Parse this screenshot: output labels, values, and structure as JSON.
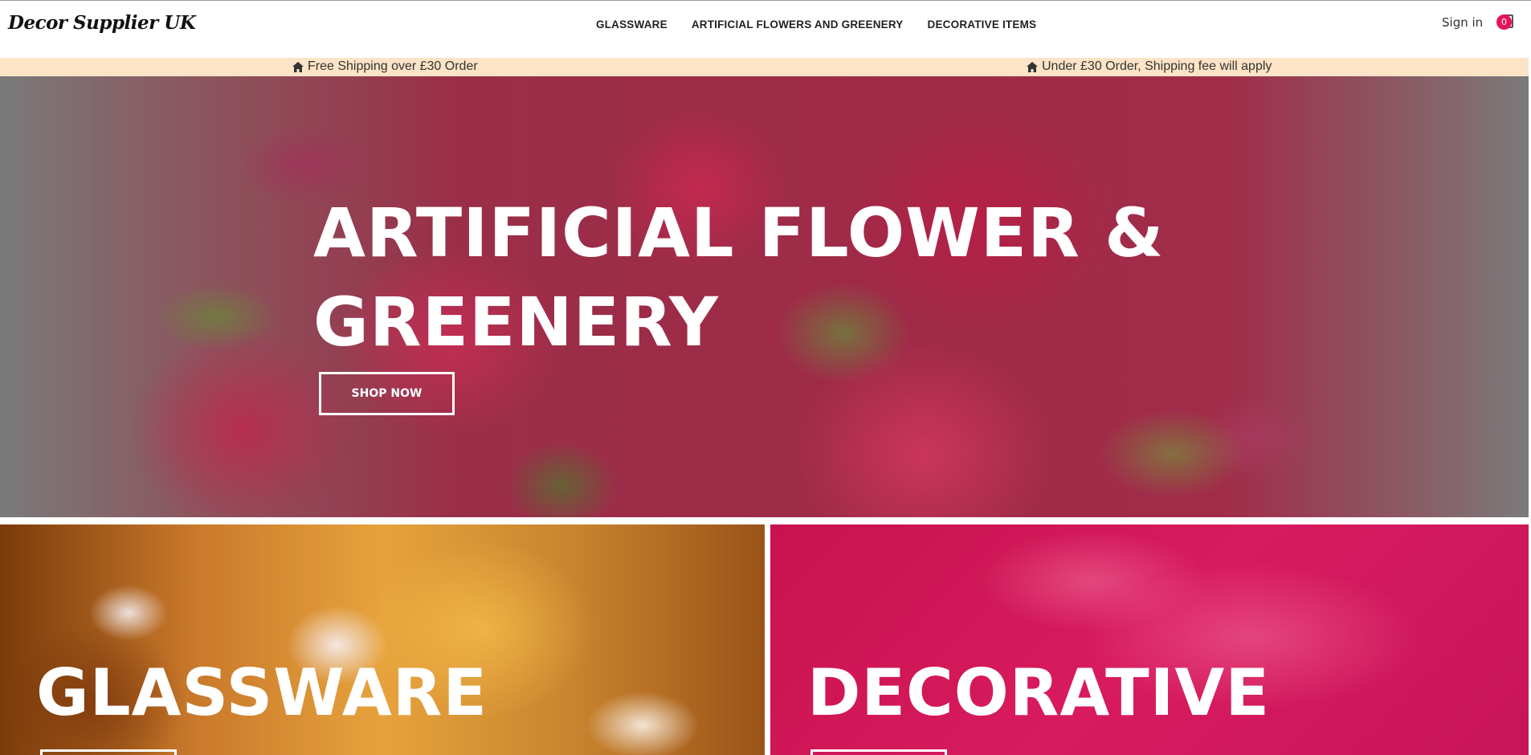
{
  "header": {
    "logo": "Decor Supplier UK",
    "nav": [
      "GLASSWARE",
      "ARTIFICIAL FLOWERS AND GREENERY",
      "DECORATIVE ITEMS"
    ],
    "signin": "Sign in",
    "cart_count": "0"
  },
  "shipping": {
    "left": "Free Shipping over £30 Order",
    "right": "Under £30 Order, Shipping fee will apply",
    "icon": "home-icon"
  },
  "hero": {
    "title_line1": "ARTIFICIAL FLOWER &",
    "title_line2": "GREENERY",
    "button": "SHOP NOW"
  },
  "tiles": {
    "glassware": "GLASSWARE",
    "decorative": "DECORATIVE"
  },
  "colors": {
    "accent": "#e5145a",
    "shipbar": "#fde4c6"
  }
}
